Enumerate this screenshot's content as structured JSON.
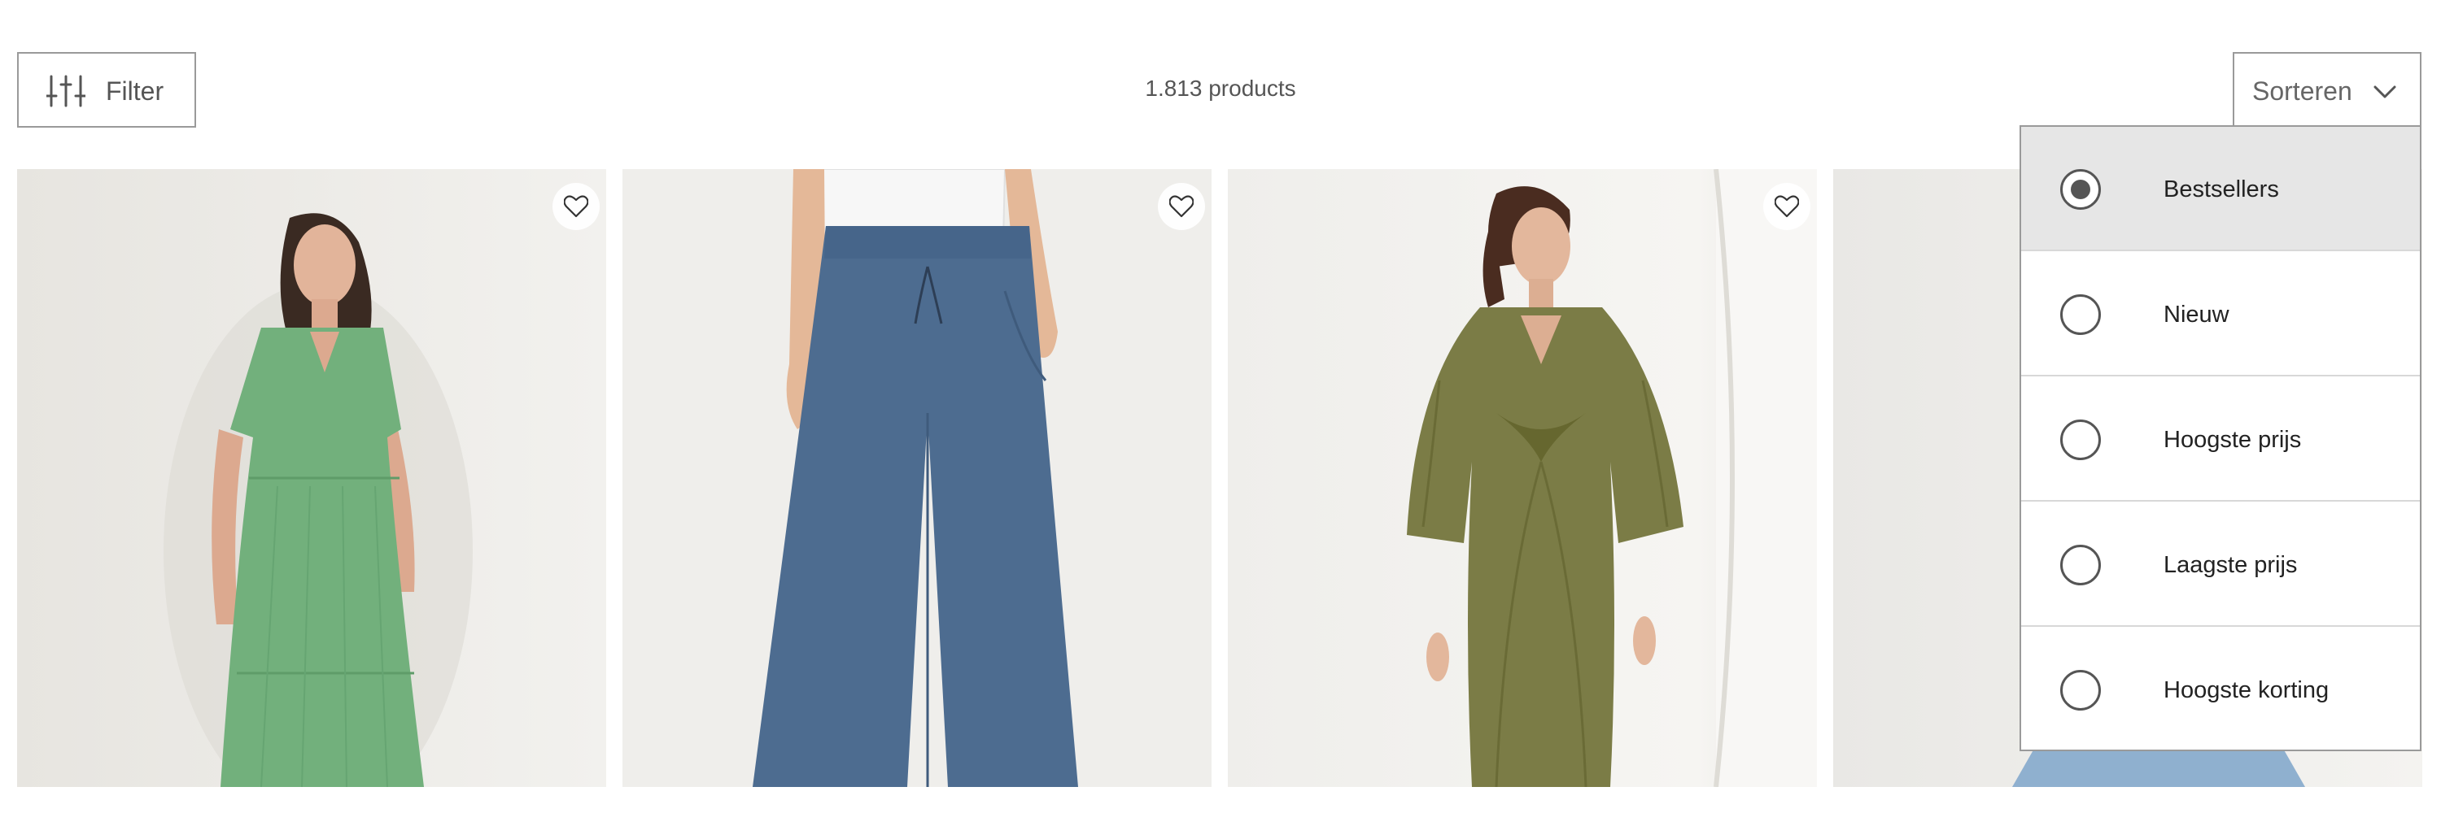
{
  "toolbar": {
    "filter": {
      "label": "Filter",
      "icon": "sliders-icon"
    },
    "product_count": "1.813 products",
    "sort": {
      "label": "Sorteren",
      "icon": "chevron-down-icon"
    }
  },
  "sort_menu": {
    "options": [
      {
        "label": "Bestsellers",
        "selected": true
      },
      {
        "label": "Nieuw",
        "selected": false
      },
      {
        "label": "Hoogste prijs",
        "selected": false
      },
      {
        "label": "Laagste prijs",
        "selected": false
      },
      {
        "label": "Hoogste korting",
        "selected": false
      }
    ]
  },
  "products": [
    {
      "image": "green-tiered-dress-photo",
      "favorite_icon": "heart-icon"
    },
    {
      "image": "chambray-wide-leg-trousers-photo",
      "favorite_icon": "heart-icon"
    },
    {
      "image": "olive-velvet-kaftan-dress-photo",
      "favorite_icon": "heart-icon"
    },
    {
      "image": "light-blue-skirt-photo",
      "favorite_icon": "heart-icon"
    }
  ],
  "colors": {
    "border": "#9a9a9a",
    "selected_option_bg": "#e6e6e6",
    "text": "#333333"
  }
}
